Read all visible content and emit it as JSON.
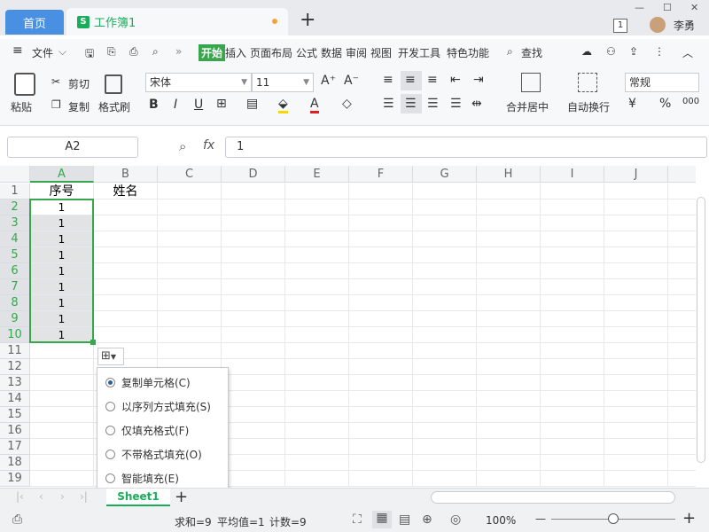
{
  "window": {
    "home_tab": "首页",
    "doc_tab": "工作簿1",
    "doc_icon": "S",
    "new_tab": "+",
    "badge": "1",
    "user": "李勇"
  },
  "menu": {
    "hamburger": "≡",
    "file": "文件",
    "items": [
      "开始",
      "插入",
      "页面布局",
      "公式",
      "数据",
      "审阅",
      "视图",
      "开发工具",
      "特色功能"
    ],
    "search": "查找"
  },
  "ribbon": {
    "paste": "粘贴",
    "cut": "剪切",
    "copy": "复制",
    "format_painter": "格式刷",
    "font": "宋体",
    "size": "11",
    "merge": "合并居中",
    "wrap": "自动换行",
    "number_format": "常规"
  },
  "formula": {
    "cell_ref": "A2",
    "fx": "fx",
    "value": "1"
  },
  "columns": [
    "A",
    "B",
    "C",
    "D",
    "E",
    "F",
    "G",
    "H",
    "I",
    "J"
  ],
  "rows": [
    "1",
    "2",
    "3",
    "4",
    "5",
    "6",
    "7",
    "8",
    "9",
    "10",
    "11",
    "12",
    "13",
    "14",
    "15",
    "16",
    "17",
    "18",
    "19"
  ],
  "cells": {
    "A1": "序号",
    "B1": "姓名",
    "A_values": [
      "1",
      "1",
      "1",
      "1",
      "1",
      "1",
      "1",
      "1",
      "1"
    ]
  },
  "autofill_menu": {
    "options": [
      "复制单元格(C)",
      "以序列方式填充(S)",
      "仅填充格式(F)",
      "不带格式填充(O)",
      "智能填充(E)"
    ],
    "selected_index": 0
  },
  "sheet": {
    "name": "Sheet1",
    "add": "+"
  },
  "status": {
    "sum": "求和=9",
    "avg": "平均值=1",
    "count": "计数=9",
    "zoom": "100%",
    "zoom_level": 1.0,
    "plus": "+",
    "minus": "—"
  },
  "colors": {
    "accent_green": "#1aad5b",
    "home_tab_blue": "#4a90e2",
    "selection_border": "#37a64d"
  }
}
